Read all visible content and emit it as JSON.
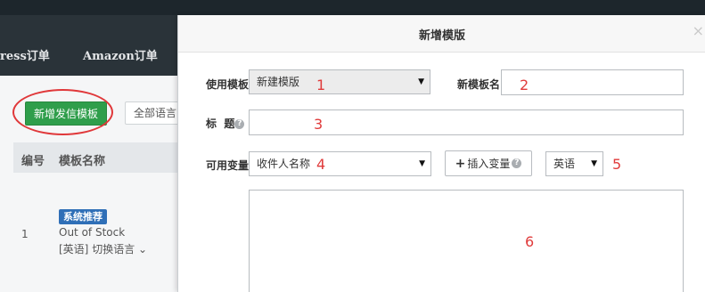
{
  "background": {
    "nav": {
      "items": [
        "ress订单",
        "Amazon订单"
      ]
    },
    "new_template_button": "新增发信模板",
    "all_language_button": "全部语言",
    "table": {
      "headers": [
        "编号",
        "模板名称"
      ],
      "rows": [
        {
          "index": "1",
          "badge": "系统推荐",
          "name": "Out of Stock",
          "lang_tag": "[英语]",
          "switch_lang": "切换语言"
        }
      ]
    }
  },
  "modal": {
    "title": "新增模版",
    "close_icon": "×",
    "use_template": {
      "label": "使用模板",
      "value": "新建模版",
      "number": "1"
    },
    "new_template_name": {
      "label": "新模板名",
      "value": "",
      "number": "2"
    },
    "title_field": {
      "label": "标  题",
      "value": "",
      "number": "3"
    },
    "available_variables": {
      "label": "可用变量",
      "value": "收件人名称",
      "number": "4"
    },
    "insert_variable_button": {
      "icon": "+",
      "label": "插入变量"
    },
    "language": {
      "value": "英语",
      "number": "5"
    },
    "body": {
      "value": "",
      "number": "6"
    }
  },
  "colors": {
    "topbar": "#1d262c",
    "nav": "#2a3339",
    "primary_green": "#2f9e4b",
    "annotation_red": "#e03b3b",
    "badge_blue": "#2f6fb7"
  },
  "icons": [
    "dropdown-arrow-icon",
    "help-icon",
    "plus-icon",
    "close-icon",
    "chevron-down-icon"
  ]
}
